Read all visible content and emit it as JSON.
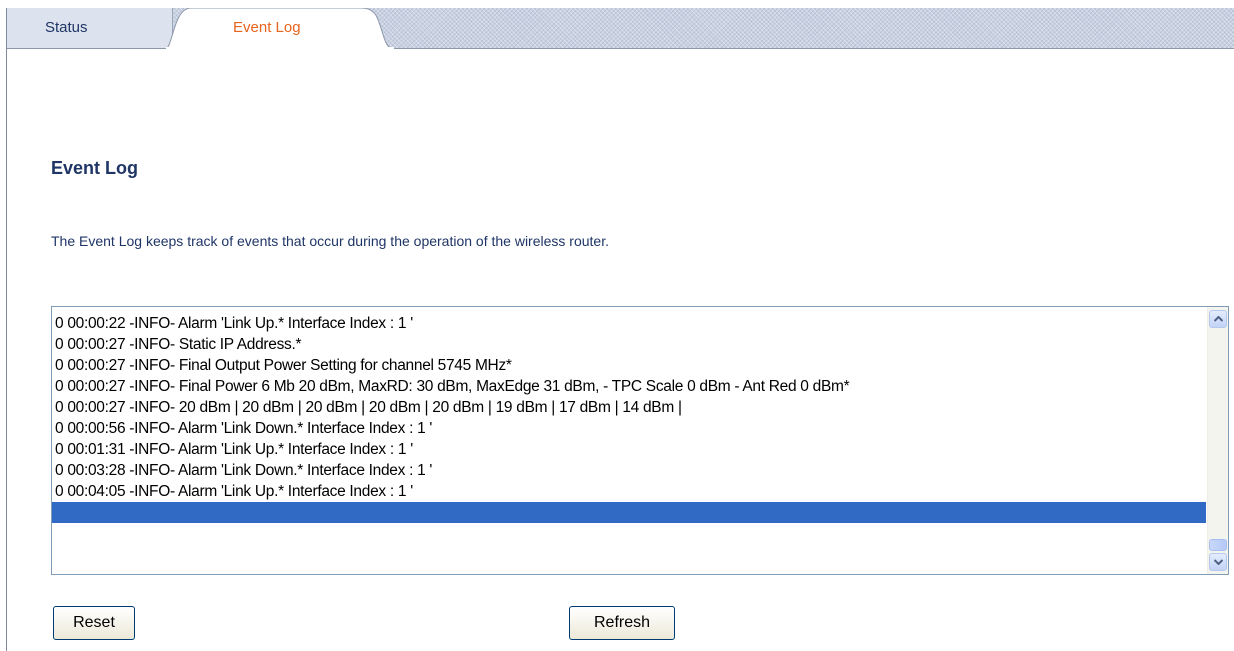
{
  "tabs": {
    "status_label": "Status",
    "event_log_label": "Event Log",
    "active": "Event Log",
    "active_color": "#e8631c",
    "inactive_color": "#1f3566"
  },
  "page": {
    "title": "Event Log",
    "description": "The Event Log keeps track of events that occur during the operation of the wireless router."
  },
  "log": {
    "lines": [
      "0 00:00:22 -INFO- Alarm 'Link Up.* Interface Index : 1 '",
      "0 00:00:27 -INFO- Static IP Address.*",
      "0 00:00:27 -INFO- Final Output Power Setting for channel 5745 MHz*",
      "0 00:00:27 -INFO- Final Power 6 Mb 20 dBm, MaxRD: 30 dBm, MaxEdge 31 dBm, - TPC Scale 0 dBm - Ant Red 0 dBm*",
      "0 00:00:27 -INFO- 20 dBm | 20 dBm | 20 dBm | 20 dBm | 20 dBm | 19 dBm | 17 dBm | 14 dBm |",
      "0 00:00:56 -INFO- Alarm 'Link Down.* Interface Index : 1 '",
      "0 00:01:31 -INFO- Alarm 'Link Up.* Interface Index : 1 '",
      "0 00:03:28 -INFO- Alarm 'Link Down.* Interface Index : 1 '",
      "0 00:04:05 -INFO- Alarm 'Link Up.* Interface Index : 1 '",
      ""
    ],
    "selected_index": 9,
    "selection_color": "#316ac5",
    "scroll_up_icon": "chevron-up-icon",
    "scroll_down_icon": "chevron-down-icon"
  },
  "buttons": {
    "reset_label": "Reset",
    "refresh_label": "Refresh"
  }
}
